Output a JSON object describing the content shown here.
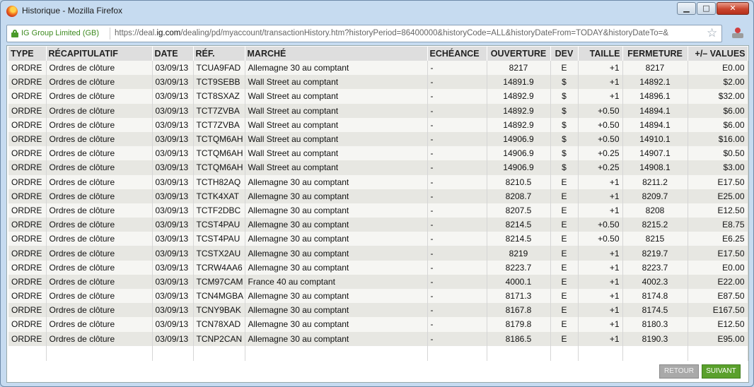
{
  "window": {
    "title": "Historique - Mozilla Firefox",
    "buttons": {
      "minimize": "▁",
      "maximize": "□",
      "close": "✕"
    }
  },
  "urlbar": {
    "site_identity": "IG Group Limited (GB)",
    "url_prefix": "https://deal.",
    "url_host": "ig.com",
    "url_rest": "/dealing/pd/myaccount/transactionHistory.htm?historyPeriod=86400000&historyCode=ALL&historyDateFrom=TODAY&historyDateTo=&",
    "icons": [
      "lock-icon",
      "star-icon",
      "addon-icon"
    ]
  },
  "table": {
    "columns": [
      "TYPE",
      "RÉCAPITULATIF",
      "DATE",
      "RÉF.",
      "MARCHÉ",
      "ECHÉANCE",
      "OUVERTURE",
      "DEV",
      "TAILLE",
      "FERMETURE",
      "+/– VALUES"
    ],
    "rows": [
      [
        "ORDRE",
        "Ordres de clôture",
        "03/09/13",
        "TCUA9FAD",
        "Allemagne 30 au comptant",
        "-",
        "8217",
        "E",
        "+1",
        "8217",
        "E0.00"
      ],
      [
        "ORDRE",
        "Ordres de clôture",
        "03/09/13",
        "TCT9SEBB",
        "Wall Street au comptant",
        "-",
        "14891.9",
        "$",
        "+1",
        "14892.1",
        "$2.00"
      ],
      [
        "ORDRE",
        "Ordres de clôture",
        "03/09/13",
        "TCT8SXAZ",
        "Wall Street au comptant",
        "-",
        "14892.9",
        "$",
        "+1",
        "14896.1",
        "$32.00"
      ],
      [
        "ORDRE",
        "Ordres de clôture",
        "03/09/13",
        "TCT7ZVBA",
        "Wall Street au comptant",
        "-",
        "14892.9",
        "$",
        "+0.50",
        "14894.1",
        "$6.00"
      ],
      [
        "ORDRE",
        "Ordres de clôture",
        "03/09/13",
        "TCT7ZVBA",
        "Wall Street au comptant",
        "-",
        "14892.9",
        "$",
        "+0.50",
        "14894.1",
        "$6.00"
      ],
      [
        "ORDRE",
        "Ordres de clôture",
        "03/09/13",
        "TCTQM6AH",
        "Wall Street au comptant",
        "-",
        "14906.9",
        "$",
        "+0.50",
        "14910.1",
        "$16.00"
      ],
      [
        "ORDRE",
        "Ordres de clôture",
        "03/09/13",
        "TCTQM6AH",
        "Wall Street au comptant",
        "-",
        "14906.9",
        "$",
        "+0.25",
        "14907.1",
        "$0.50"
      ],
      [
        "ORDRE",
        "Ordres de clôture",
        "03/09/13",
        "TCTQM6AH",
        "Wall Street au comptant",
        "-",
        "14906.9",
        "$",
        "+0.25",
        "14908.1",
        "$3.00"
      ],
      [
        "ORDRE",
        "Ordres de clôture",
        "03/09/13",
        "TCTH82AQ",
        "Allemagne 30 au comptant",
        "-",
        "8210.5",
        "E",
        "+1",
        "8211.2",
        "E17.50"
      ],
      [
        "ORDRE",
        "Ordres de clôture",
        "03/09/13",
        "TCTK4XAT",
        "Allemagne 30 au comptant",
        "-",
        "8208.7",
        "E",
        "+1",
        "8209.7",
        "E25.00"
      ],
      [
        "ORDRE",
        "Ordres de clôture",
        "03/09/13",
        "TCTF2DBC",
        "Allemagne 30 au comptant",
        "-",
        "8207.5",
        "E",
        "+1",
        "8208",
        "E12.50"
      ],
      [
        "ORDRE",
        "Ordres de clôture",
        "03/09/13",
        "TCST4PAU",
        "Allemagne 30 au comptant",
        "-",
        "8214.5",
        "E",
        "+0.50",
        "8215.2",
        "E8.75"
      ],
      [
        "ORDRE",
        "Ordres de clôture",
        "03/09/13",
        "TCST4PAU",
        "Allemagne 30 au comptant",
        "-",
        "8214.5",
        "E",
        "+0.50",
        "8215",
        "E6.25"
      ],
      [
        "ORDRE",
        "Ordres de clôture",
        "03/09/13",
        "TCSTX2AU",
        "Allemagne 30 au comptant",
        "-",
        "8219",
        "E",
        "+1",
        "8219.7",
        "E17.50"
      ],
      [
        "ORDRE",
        "Ordres de clôture",
        "03/09/13",
        "TCRW4AA6",
        "Allemagne 30 au comptant",
        "-",
        "8223.7",
        "E",
        "+1",
        "8223.7",
        "E0.00"
      ],
      [
        "ORDRE",
        "Ordres de clôture",
        "03/09/13",
        "TCM97CAM",
        "France 40 au comptant",
        "-",
        "4000.1",
        "E",
        "+1",
        "4002.3",
        "E22.00"
      ],
      [
        "ORDRE",
        "Ordres de clôture",
        "03/09/13",
        "TCN4MGBA",
        "Allemagne 30 au comptant",
        "-",
        "8171.3",
        "E",
        "+1",
        "8174.8",
        "E87.50"
      ],
      [
        "ORDRE",
        "Ordres de clôture",
        "03/09/13",
        "TCNY9BAK",
        "Allemagne 30 au comptant",
        "-",
        "8167.8",
        "E",
        "+1",
        "8174.5",
        "E167.50"
      ],
      [
        "ORDRE",
        "Ordres de clôture",
        "03/09/13",
        "TCN78XAD",
        "Allemagne 30 au comptant",
        "-",
        "8179.8",
        "E",
        "+1",
        "8180.3",
        "E12.50"
      ],
      [
        "ORDRE",
        "Ordres de clôture",
        "03/09/13",
        "TCNP2CAN",
        "Allemagne 30 au comptant",
        "-",
        "8186.5",
        "E",
        "+1",
        "8190.3",
        "E95.00"
      ]
    ]
  },
  "pagination": {
    "back_label": "RETOUR",
    "next_label": "SUIVANT"
  },
  "colors": {
    "next_button": "#5aa02c",
    "back_button": "#a9a9a9",
    "site_identity": "#3d8a1f"
  }
}
